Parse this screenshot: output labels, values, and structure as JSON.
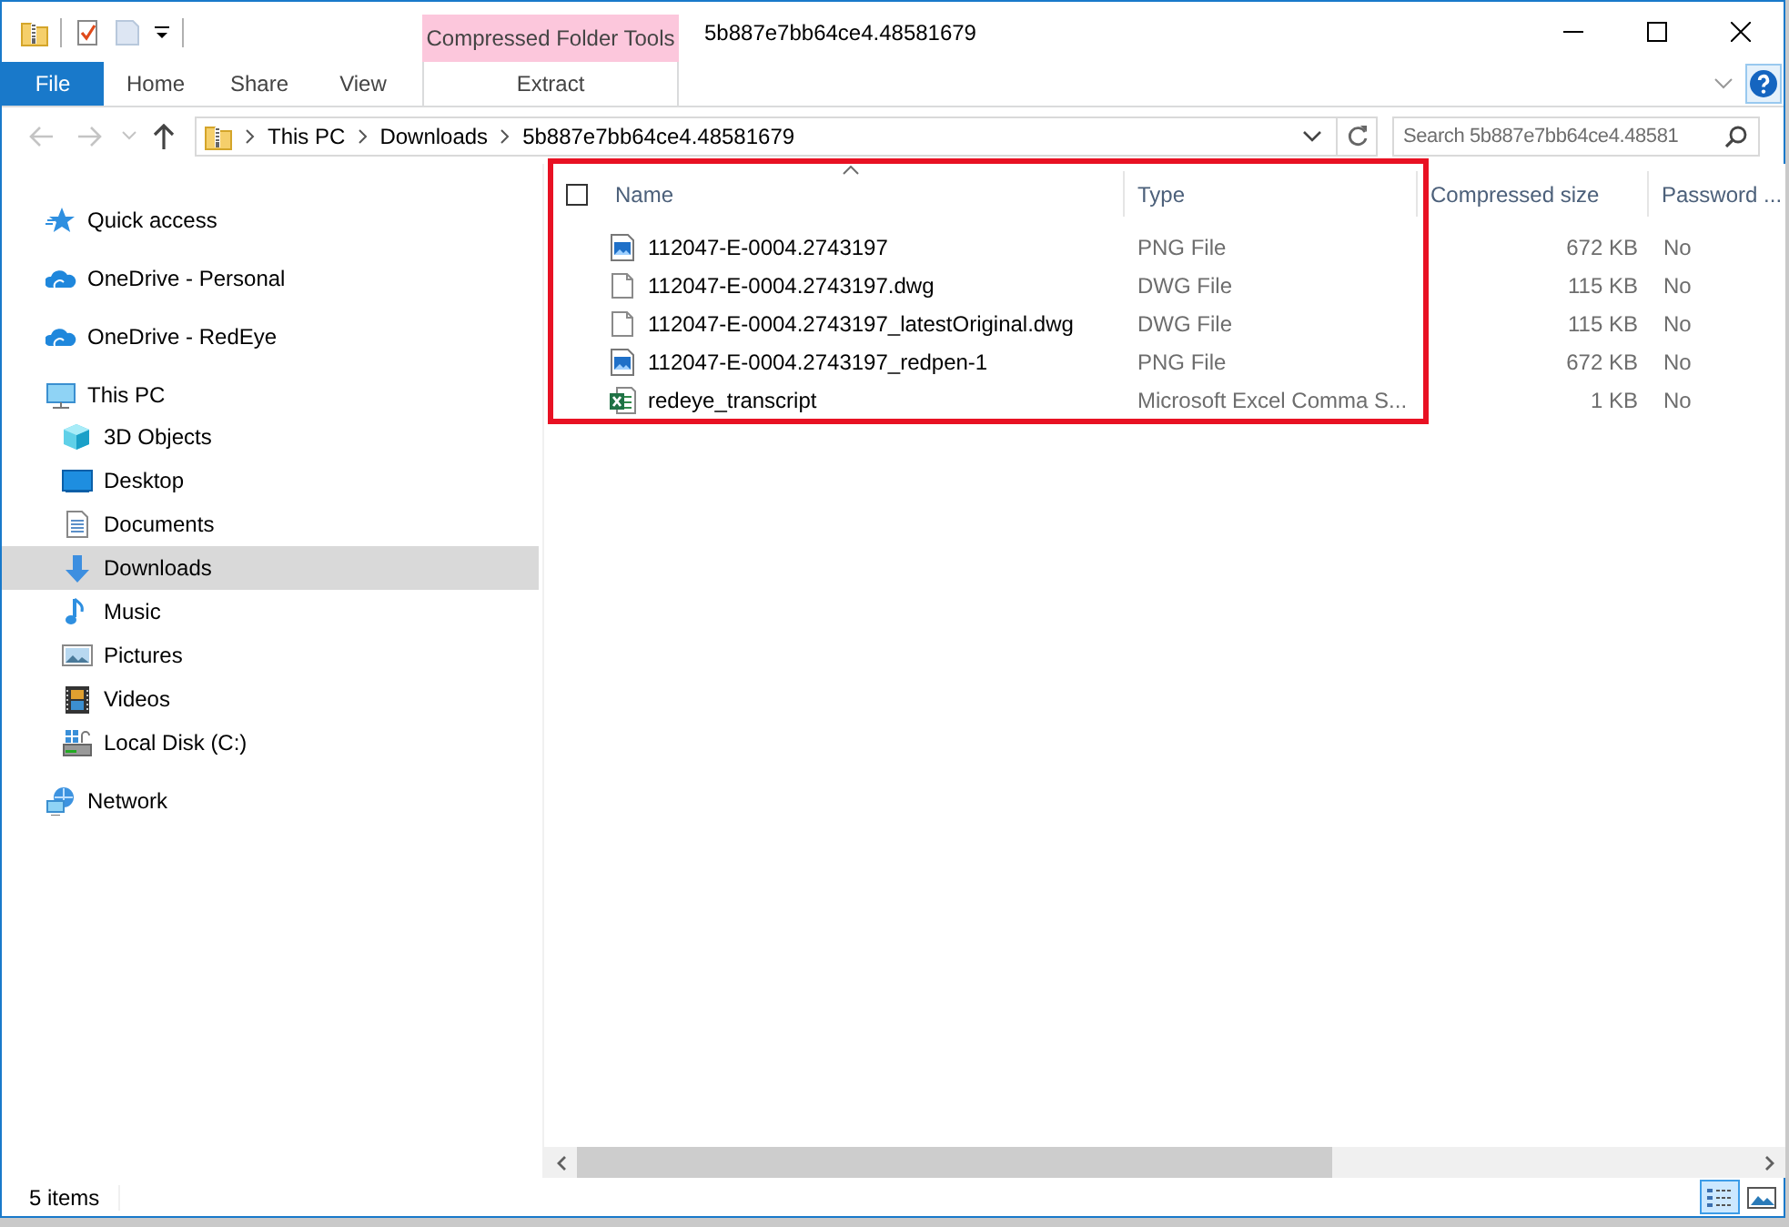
{
  "window": {
    "title": "5b887e7bb64ce4.48581679"
  },
  "ribbon": {
    "contextual_group": "Compressed Folder Tools",
    "tabs": [
      {
        "label": "File",
        "kind": "file"
      },
      {
        "label": "Home",
        "kind": "tab"
      },
      {
        "label": "Share",
        "kind": "tab"
      },
      {
        "label": "View",
        "kind": "tab"
      },
      {
        "label": "Extract",
        "kind": "contextual"
      }
    ]
  },
  "address_bar": {
    "crumbs": [
      "This PC",
      "Downloads",
      "5b887e7bb64ce4.48581679"
    ]
  },
  "search": {
    "placeholder": "Search 5b887e7bb64ce4.48581"
  },
  "nav_pane": {
    "items": [
      {
        "label": "Quick access",
        "kind": "quick-access",
        "selected": false
      },
      {
        "label": "OneDrive - Personal",
        "kind": "cloud",
        "selected": false
      },
      {
        "label": "OneDrive - RedEye",
        "kind": "cloud",
        "selected": false
      },
      {
        "label": "This PC",
        "kind": "computer",
        "selected": false,
        "children": [
          {
            "label": "3D Objects",
            "kind": "cube",
            "selected": false
          },
          {
            "label": "Desktop",
            "kind": "desktop",
            "selected": false
          },
          {
            "label": "Documents",
            "kind": "documents",
            "selected": false
          },
          {
            "label": "Downloads",
            "kind": "downloads",
            "selected": true
          },
          {
            "label": "Music",
            "kind": "music",
            "selected": false
          },
          {
            "label": "Pictures",
            "kind": "pictures",
            "selected": false
          },
          {
            "label": "Videos",
            "kind": "videos",
            "selected": false
          },
          {
            "label": "Local Disk (C:)",
            "kind": "disk",
            "selected": false
          }
        ]
      },
      {
        "label": "Network",
        "kind": "network",
        "selected": false
      }
    ]
  },
  "file_list": {
    "select_all": {
      "checked": false
    },
    "columns": [
      {
        "label": "Name",
        "sorted": true
      },
      {
        "label": "Type",
        "sorted": false
      },
      {
        "label": "Compressed size",
        "sorted": false
      },
      {
        "label": "Password ...",
        "sorted": false
      }
    ],
    "rows": [
      {
        "name": "112047-E-0004.2743197",
        "kind": "image",
        "type": "PNG File",
        "size": "672 KB",
        "password": "No"
      },
      {
        "name": "112047-E-0004.2743197.dwg",
        "kind": "document",
        "type": "DWG File",
        "size": "115 KB",
        "password": "No"
      },
      {
        "name": "112047-E-0004.2743197_latestOriginal.dwg",
        "kind": "document",
        "type": "DWG File",
        "size": "115 KB",
        "password": "No"
      },
      {
        "name": "112047-E-0004.2743197_redpen-1",
        "kind": "image",
        "type": "PNG File",
        "size": "672 KB",
        "password": "No"
      },
      {
        "name": "redeye_transcript",
        "kind": "spreadsheet",
        "type": "Microsoft Excel Comma S...",
        "size": "1 KB",
        "password": "No"
      }
    ],
    "highlight_box": true
  },
  "status_bar": {
    "item_count": "5 items",
    "views": [
      {
        "kind": "details",
        "selected": true
      },
      {
        "kind": "large-icons",
        "selected": false
      }
    ]
  }
}
